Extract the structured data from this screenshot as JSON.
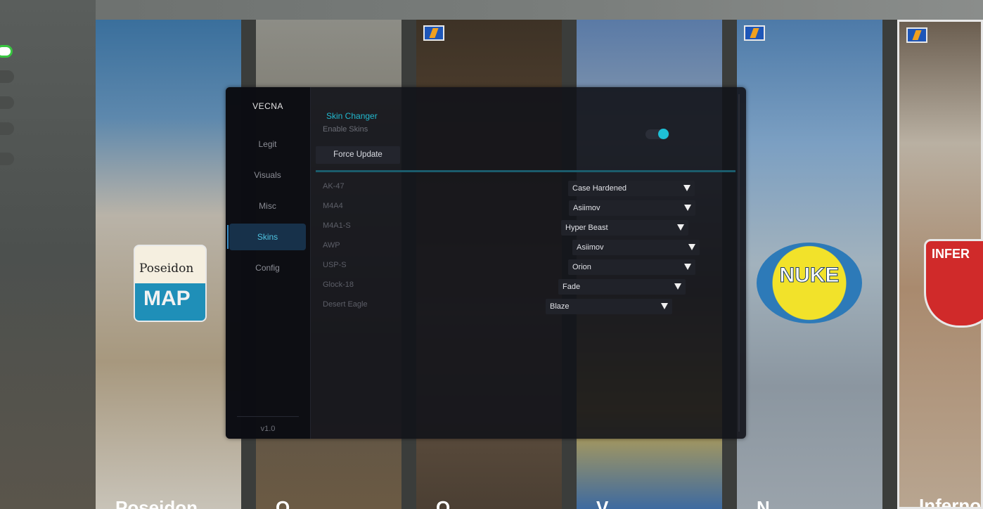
{
  "background": {
    "map_cards": [
      {
        "label": "Poseidon"
      },
      {
        "label": "O"
      },
      {
        "label": "O"
      },
      {
        "label": "V"
      },
      {
        "label": "N"
      },
      {
        "label": "Inferno"
      }
    ],
    "poseidon_badge": {
      "title": "Poseidon",
      "subtitle": "MAP"
    },
    "nuke_badge": {
      "title": "NUKE"
    },
    "inferno_badge": {
      "title": "INFER"
    }
  },
  "menu": {
    "brand": "VECNA",
    "nav": [
      {
        "label": "Legit"
      },
      {
        "label": "Visuals"
      },
      {
        "label": "Misc"
      },
      {
        "label": "Skins"
      },
      {
        "label": "Config"
      }
    ],
    "active_nav": "Skins",
    "version": "v1.0",
    "colors": {
      "accent": "#22b9cf",
      "active_nav_bg": "#17314a",
      "panel": "#12131a"
    }
  },
  "skins": {
    "section_title": "Skin Changer",
    "enable_label": "Enable Skins",
    "enable_on": true,
    "force_update_label": "Force Update",
    "weapons": [
      {
        "weapon": "AK-47",
        "skin": "Case Hardened"
      },
      {
        "weapon": "M4A4",
        "skin": "Asiimov"
      },
      {
        "weapon": "M4A1-S",
        "skin": "Hyper Beast"
      },
      {
        "weapon": "AWP",
        "skin": "Asiimov"
      },
      {
        "weapon": "USP-S",
        "skin": "Orion"
      },
      {
        "weapon": "Glock-18",
        "skin": "Fade"
      },
      {
        "weapon": "Desert Eagle",
        "skin": "Blaze"
      }
    ]
  }
}
